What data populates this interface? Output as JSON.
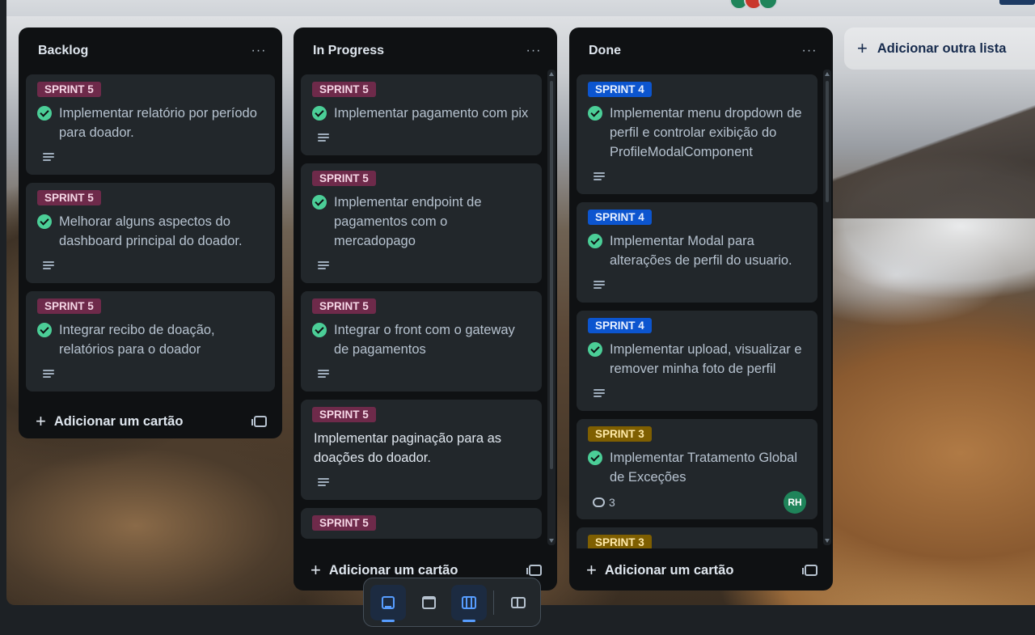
{
  "lists": [
    {
      "title": "Backlog",
      "menu": "···",
      "cards": [
        {
          "badge": "SPRINT 5",
          "title": "Implementar relatório por período para doador.",
          "done": true
        },
        {
          "badge": "SPRINT 5",
          "title": "Melhorar alguns aspectos do dashboard principal do doador.",
          "done": true
        },
        {
          "badge": "SPRINT 5",
          "title": "Integrar recibo de doação, relatórios para o doador",
          "done": true
        }
      ],
      "add_card": "Adicionar um cartão"
    },
    {
      "title": "In Progress",
      "menu": "···",
      "cards": [
        {
          "badge": "SPRINT 5",
          "title": "Implementar pagamento com pix",
          "done": true
        },
        {
          "badge": "SPRINT 5",
          "title": "Implementar endpoint de pagamentos com o mercadopago",
          "done": true
        },
        {
          "badge": "SPRINT 5",
          "title": "Integrar o front com o gateway de pagamentos",
          "done": true
        },
        {
          "badge": "SPRINT 5",
          "title": "Implementar paginação para as doações do doador.",
          "done": false
        },
        {
          "badge": "SPRINT 5",
          "title": "",
          "done": false
        }
      ],
      "add_card": "Adicionar um cartão"
    },
    {
      "title": "Done",
      "menu": "···",
      "cards": [
        {
          "badge": "SPRINT 4",
          "title": "Implementar menu dropdown de perfil e controlar exibição do ProfileModalComponent",
          "done": true
        },
        {
          "badge": "SPRINT 4",
          "title": "Implementar Modal para alterações de perfil do usuario.",
          "done": true
        },
        {
          "badge": "SPRINT 4",
          "title": "Implementar upload, visualizar e remover minha foto de perfil",
          "done": true
        },
        {
          "badge": "SPRINT 3",
          "title": "Implementar Tratamento Global de Exceções",
          "done": true,
          "comments": "3",
          "member": "RH"
        },
        {
          "badge": "SPRINT 3",
          "title": "",
          "done": false
        }
      ],
      "add_card": "Adicionar um cartão"
    }
  ],
  "add_list": "Adicionar outra lista",
  "switcher": {
    "items": [
      "inbox-icon",
      "calendar-icon",
      "board-icon",
      "switch-boards-icon"
    ]
  },
  "colors": {
    "sprint5": "#6e2a4a",
    "sprint4": "#0c55cf",
    "sprint3": "#7f5f01",
    "done_check": "#4bce97",
    "accent": "#579dff"
  }
}
